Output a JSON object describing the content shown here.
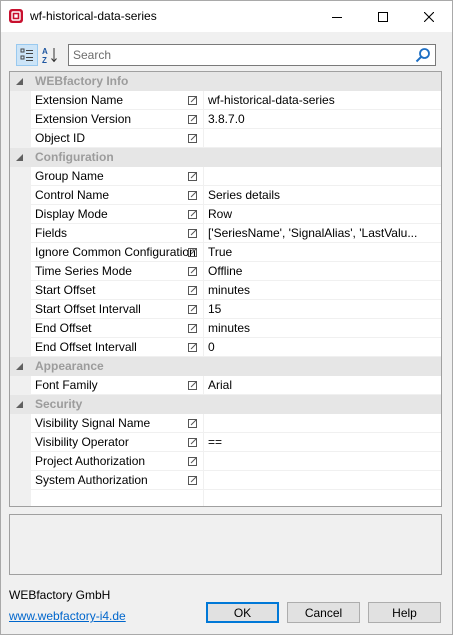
{
  "window": {
    "title": "wf-historical-data-series",
    "icon": "webfactory-app-icon"
  },
  "toolbar": {
    "categorized_icon": "categorized-view-icon",
    "alphabetical_icon": "sort-alphabetical-icon",
    "search_placeholder": "Search"
  },
  "grid": {
    "categories": [
      {
        "label": "WEBfactory Info",
        "rows": [
          {
            "name": "Extension Name",
            "value": "wf-historical-data-series"
          },
          {
            "name": "Extension Version",
            "value": "3.8.7.0"
          },
          {
            "name": "Object ID",
            "value": ""
          }
        ]
      },
      {
        "label": "Configuration",
        "rows": [
          {
            "name": "Group Name",
            "value": ""
          },
          {
            "name": "Control Name",
            "value": "Series details"
          },
          {
            "name": "Display Mode",
            "value": "Row"
          },
          {
            "name": "Fields",
            "value": "['SeriesName', 'SignalAlias', 'LastValu..."
          },
          {
            "name": "Ignore Common Configuration",
            "value": "True"
          },
          {
            "name": "Time Series Mode",
            "value": "Offline"
          },
          {
            "name": "Start Offset",
            "value": "minutes"
          },
          {
            "name": "Start Offset Intervall",
            "value": "15"
          },
          {
            "name": "End Offset",
            "value": "minutes"
          },
          {
            "name": "End Offset Intervall",
            "value": "0"
          }
        ]
      },
      {
        "label": "Appearance",
        "rows": [
          {
            "name": "Font Family",
            "value": "Arial"
          }
        ]
      },
      {
        "label": "Security",
        "rows": [
          {
            "name": "Visibility Signal Name",
            "value": ""
          },
          {
            "name": "Visibility Operator",
            "value": "=="
          },
          {
            "name": "Project Authorization",
            "value": ""
          },
          {
            "name": "System Authorization",
            "value": ""
          }
        ]
      }
    ]
  },
  "footer": {
    "company": "WEBfactory GmbH",
    "link": "www.webfactory-i4.de",
    "ok_label": "OK",
    "cancel_label": "Cancel",
    "help_label": "Help"
  }
}
